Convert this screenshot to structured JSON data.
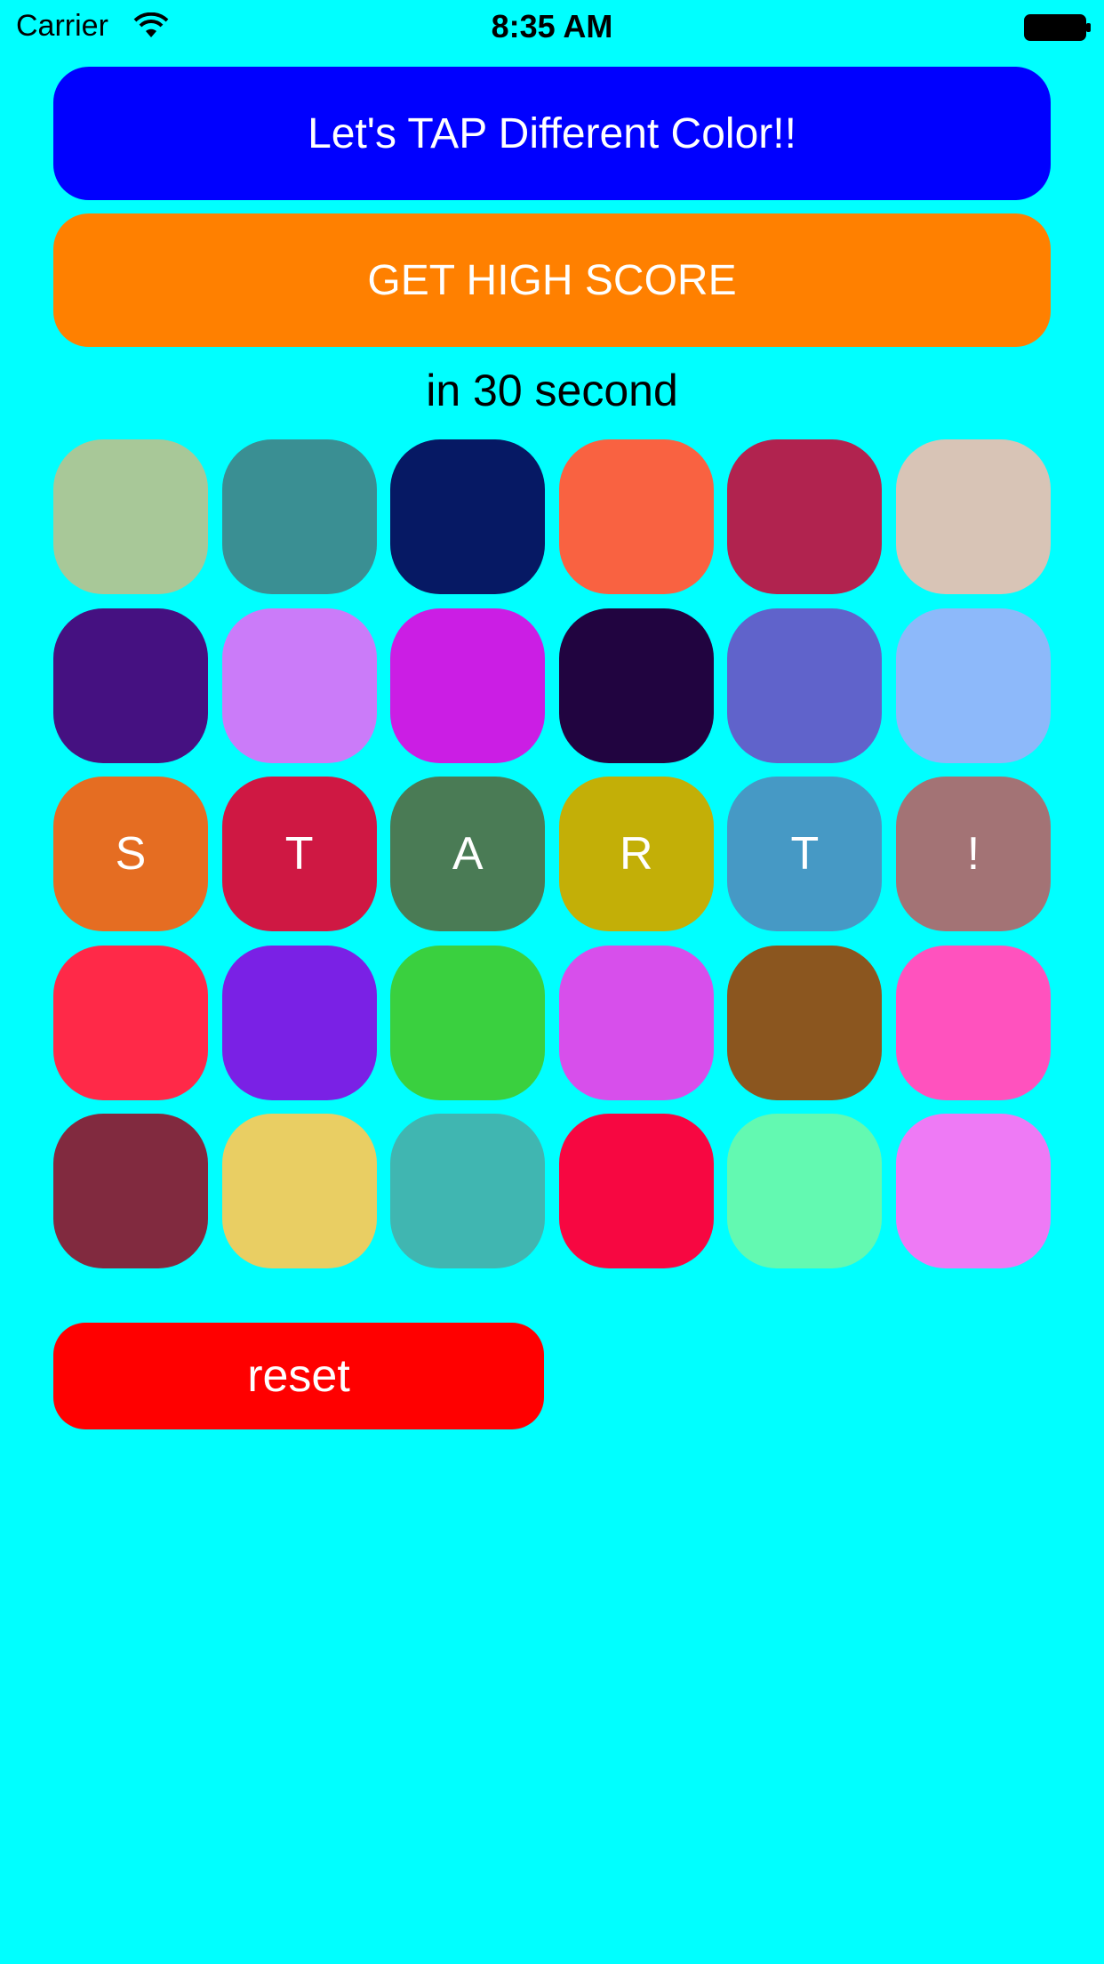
{
  "status_bar": {
    "carrier": "Carrier",
    "time": "8:35 AM",
    "wifi_icon": "wifi-icon",
    "battery_icon": "battery-icon"
  },
  "header": {
    "title": "Let's TAP Different Color!!",
    "title_color": "#0000FF",
    "score_button": "GET HIGH SCORE",
    "score_color": "#FF8000",
    "subtitle": "in 30 second"
  },
  "grid": {
    "tiles": [
      {
        "label": "",
        "color": "#A8C898"
      },
      {
        "label": "",
        "color": "#3A8F93"
      },
      {
        "label": "",
        "color": "#061964"
      },
      {
        "label": "",
        "color": "#F96241"
      },
      {
        "label": "",
        "color": "#B1234F"
      },
      {
        "label": "",
        "color": "#D8C4B6"
      },
      {
        "label": "",
        "color": "#451181"
      },
      {
        "label": "",
        "color": "#CB7BF9"
      },
      {
        "label": "",
        "color": "#CB1EE4"
      },
      {
        "label": "",
        "color": "#210440"
      },
      {
        "label": "",
        "color": "#6063CB"
      },
      {
        "label": "",
        "color": "#8DB9FA"
      },
      {
        "label": "S",
        "color": "#E56D22"
      },
      {
        "label": "T",
        "color": "#CF1843"
      },
      {
        "label": "A",
        "color": "#4A7B55"
      },
      {
        "label": "R",
        "color": "#C3AF07"
      },
      {
        "label": "T",
        "color": "#4699C5"
      },
      {
        "label": "!",
        "color": "#A37375"
      },
      {
        "label": "",
        "color": "#FF2948"
      },
      {
        "label": "",
        "color": "#7A21E5"
      },
      {
        "label": "",
        "color": "#3AD03F"
      },
      {
        "label": "",
        "color": "#D74FEB"
      },
      {
        "label": "",
        "color": "#8B561F"
      },
      {
        "label": "",
        "color": "#FF52BE"
      },
      {
        "label": "",
        "color": "#812A3F"
      },
      {
        "label": "",
        "color": "#E9CE63"
      },
      {
        "label": "",
        "color": "#40B6B1"
      },
      {
        "label": "",
        "color": "#F70741"
      },
      {
        "label": "",
        "color": "#63F9B1"
      },
      {
        "label": "",
        "color": "#EE7AF5"
      }
    ]
  },
  "footer": {
    "reset_label": "reset",
    "reset_color": "#FF0000"
  }
}
